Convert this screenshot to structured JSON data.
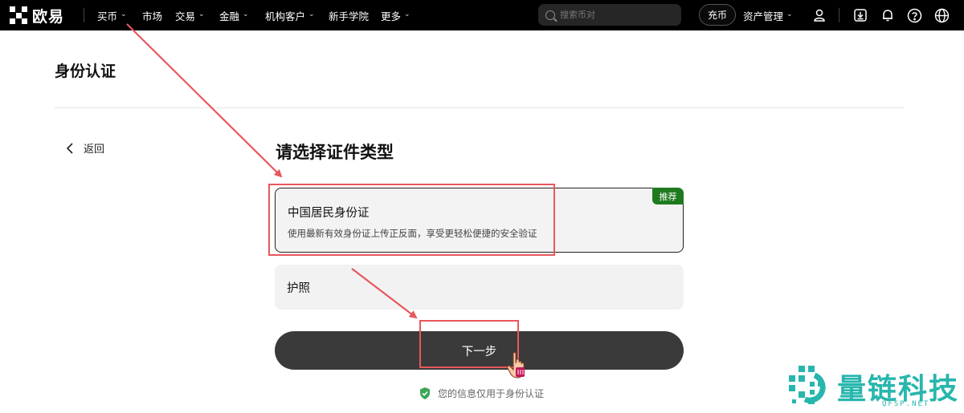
{
  "nav": {
    "logo_text": "欧易",
    "items": [
      {
        "label": "买币",
        "has_chevron": true
      },
      {
        "label": "市场",
        "has_chevron": false
      },
      {
        "label": "交易",
        "has_chevron": true
      },
      {
        "label": "金融",
        "has_chevron": true
      },
      {
        "label": "机构客户",
        "has_chevron": true
      },
      {
        "label": "新手学院",
        "has_chevron": false
      },
      {
        "label": "更多",
        "has_chevron": true
      }
    ],
    "chevron_glyph": "⌄",
    "search_placeholder": "搜索币对",
    "deposit_label": "充币",
    "asset_menu_label": "资产管理",
    "icons": [
      "user-icon",
      "download-icon",
      "bell-icon",
      "help-icon",
      "globe-icon"
    ]
  },
  "page": {
    "title": "身份认证",
    "back_label": "返回",
    "section_title": "请选择证件类型",
    "options": [
      {
        "title": "中国居民身份证",
        "description": "使用最新有效身份证上传正反面，享受更轻松便捷的安全验证",
        "badge": "推荐",
        "selected": true
      },
      {
        "title": "护照",
        "selected": false
      }
    ],
    "next_button_label": "下一步",
    "privacy_note": "您的信息仅用于身份认证"
  },
  "watermark": {
    "text": "量链科技",
    "sub": "QFSP.NET"
  },
  "colors": {
    "nav_bg": "#000000",
    "badge_green": "#1f7a1f",
    "shield_green": "#3aa655",
    "next_button": "#3a3a3a",
    "annotation_red": "#e8575c",
    "watermark_teal": "#27b6ad"
  }
}
